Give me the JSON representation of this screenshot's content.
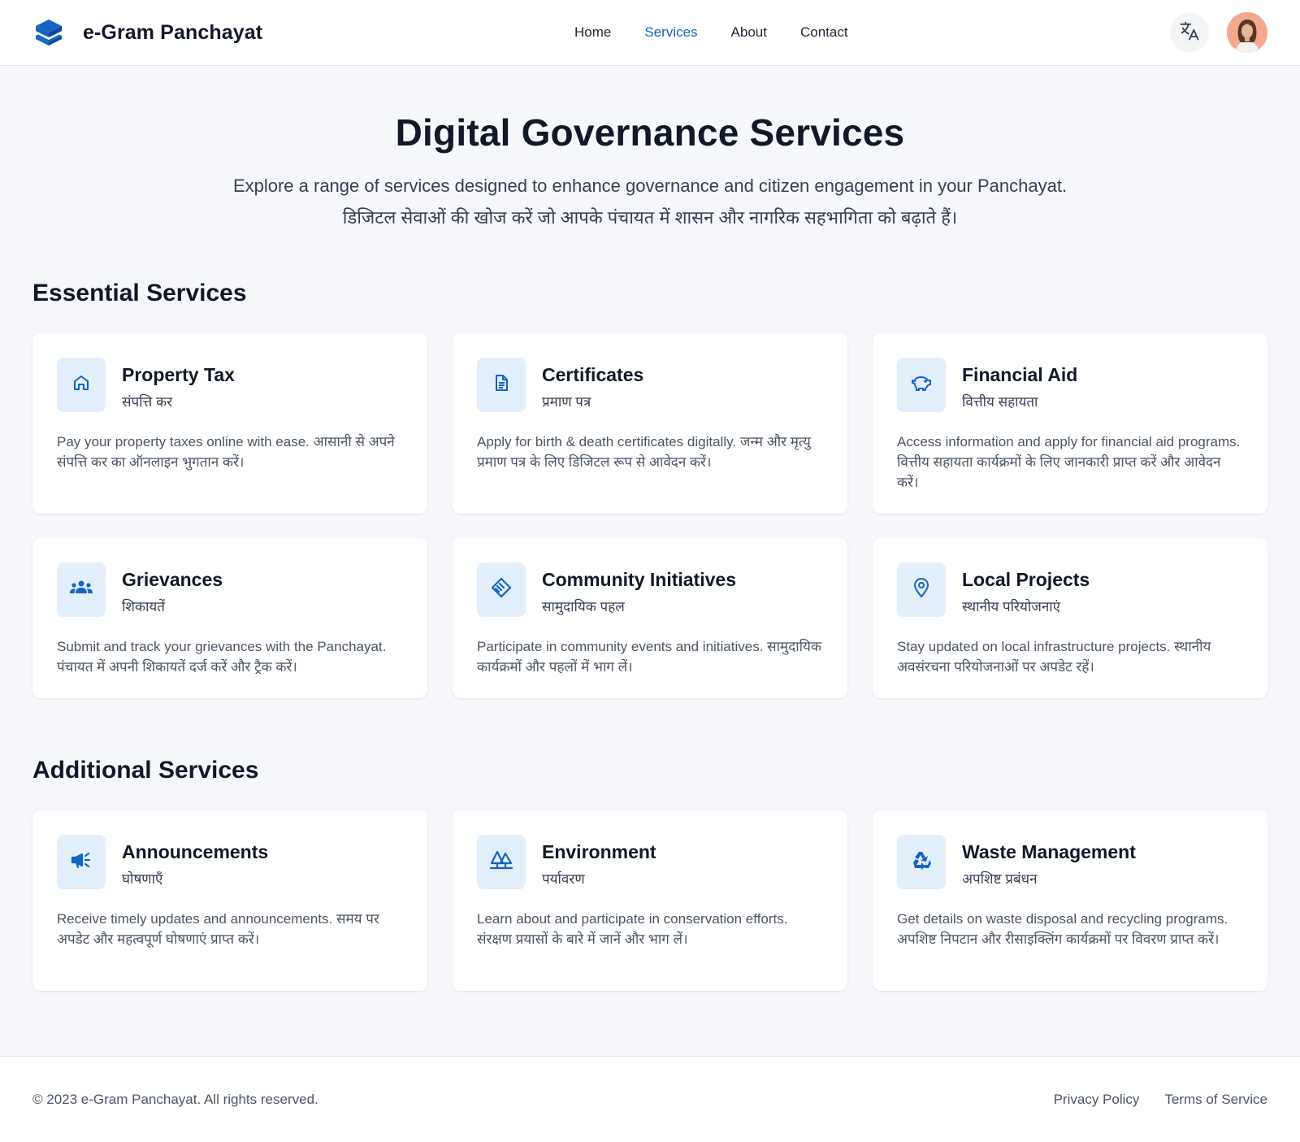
{
  "header": {
    "brand_name": "e-Gram Panchayat",
    "logo_icon": "layers-icon",
    "nav": [
      "Home",
      "Services",
      "About",
      "Contact"
    ],
    "active_nav": "Services",
    "translate_icon": "translate-icon"
  },
  "hero": {
    "title": "Digital Governance Services",
    "subtitle_en": "Explore a range of services designed to enhance governance and citizen engagement in your Panchayat.",
    "subtitle_hi": "डिजिटल सेवाओं की खोज करें जो आपके पंचायत में शासन और नागरिक सहभागिता को बढ़ाते हैं।"
  },
  "essential": {
    "heading": "Essential Services",
    "cards": [
      {
        "icon": "home-icon",
        "title": "Property Tax",
        "subtitle": "संपत्ति कर",
        "desc": "Pay your property taxes online with ease. आसानी से अपने संपत्ति कर का ऑनलाइन भुगतान करें।"
      },
      {
        "icon": "document-icon",
        "title": "Certificates",
        "subtitle": "प्रमाण पत्र",
        "desc": "Apply for birth & death certificates digitally. जन्म और मृत्यु प्रमाण पत्र के लिए डिजिटल रूप से आवेदन करें।"
      },
      {
        "icon": "piggy-bank-icon",
        "title": "Financial Aid",
        "subtitle": "वित्तीय सहायता",
        "desc": "Access information and apply for financial aid programs. वित्तीय सहायता कार्यक्रमों के लिए जानकारी प्राप्त करें और आवेदन करें।"
      },
      {
        "icon": "groups-icon",
        "title": "Grievances",
        "subtitle": "शिकायतें",
        "desc": "Submit and track your grievances with the Panchayat. पंचायत में अपनी शिकायतें दर्ज करें और ट्रैक करें।"
      },
      {
        "icon": "handshake-icon",
        "title": "Community Initiatives",
        "subtitle": "सामुदायिक पहल",
        "desc": "Participate in community events and initiatives. सामुदायिक कार्यक्रमों और पहलों में भाग लें।"
      },
      {
        "icon": "location-pin-icon",
        "title": "Local Projects",
        "subtitle": "स्थानीय परियोजनाएं",
        "desc": "Stay updated on local infrastructure projects. स्थानीय अवसंरचना परियोजनाओं पर अपडेट रहें।"
      }
    ]
  },
  "additional": {
    "heading": "Additional Services",
    "cards": [
      {
        "icon": "megaphone-icon",
        "title": "Announcements",
        "subtitle": "घोषणाएँ",
        "desc": "Receive timely updates and announcements. समय पर अपडेट और महत्वपूर्ण घोषणाएं प्राप्त करें।"
      },
      {
        "icon": "forest-icon",
        "title": "Environment",
        "subtitle": "पर्यावरण",
        "desc": "Learn about and participate in conservation efforts. संरक्षण प्रयासों के बारे में जानें और भाग लें।"
      },
      {
        "icon": "recycle-icon",
        "title": "Waste Management",
        "subtitle": "अपशिष्ट प्रबंधन",
        "desc": "Get details on waste disposal and recycling programs. अपशिष्ट निपटान और रीसाइक्लिंग कार्यक्रमों पर विवरण प्राप्त करें।"
      }
    ]
  },
  "footer": {
    "copyright": "© 2023 e-Gram Panchayat. All rights reserved.",
    "links": [
      "Privacy Policy",
      "Terms of Service"
    ]
  },
  "colors": {
    "accent": "#1565c0",
    "icon_bg": "#e3eefb",
    "page_bg": "#f5f7fa"
  }
}
